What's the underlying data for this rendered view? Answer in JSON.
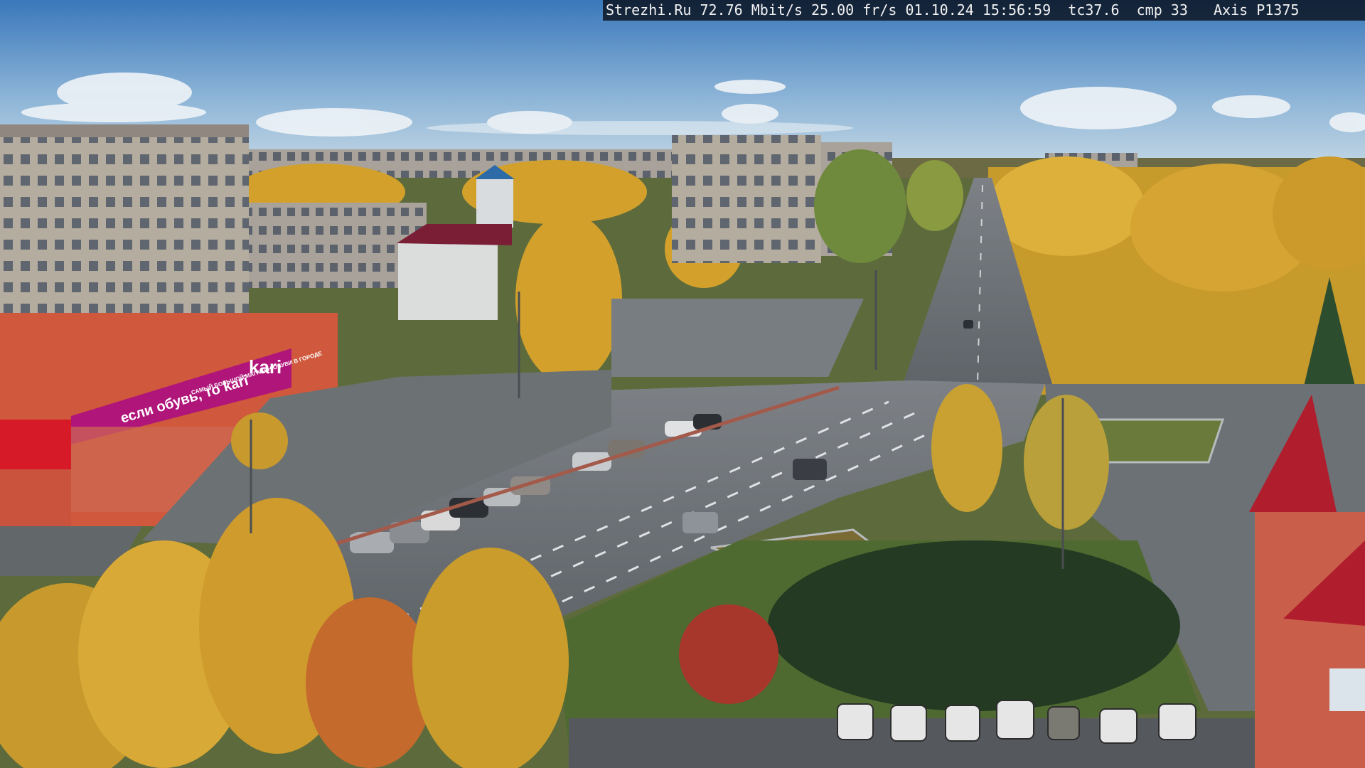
{
  "camera_overlay": {
    "site": "Strezhi.Ru",
    "bitrate": "72.76 Mbit/s",
    "framerate": "25.00 fr/s",
    "date": "01.10.24",
    "time": "15:56:59",
    "temp": "tc37.6",
    "compression": "cmp 33",
    "model": "Axis P1375"
  },
  "storefront": {
    "brand": "kari",
    "banner_slogan": "если обувь, то kari",
    "banner_small": "САМЫЙ БОЛЬШОЙ МАГАЗИН ОБУВИ В ГОРОДЕ"
  },
  "colors": {
    "sky_top": "#3f7fc0",
    "sky_bottom": "#b9d3e6",
    "brand_magenta": "#b0157a",
    "building_red": "#c84a34",
    "asphalt": "#6e7378",
    "birch_gold": "#d9a52a"
  }
}
